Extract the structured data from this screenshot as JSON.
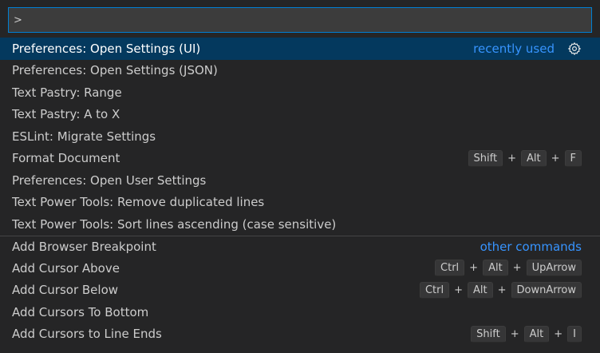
{
  "input": {
    "value": ">",
    "placeholder": ""
  },
  "items": [
    {
      "label": "Preferences: Open Settings (UI)",
      "group": "recently used",
      "keys": [],
      "selected": true,
      "separator": false,
      "gear": true
    },
    {
      "label": "Preferences: Open Settings (JSON)",
      "group": "",
      "keys": [],
      "selected": false,
      "separator": false,
      "gear": false
    },
    {
      "label": "Text Pastry: Range",
      "group": "",
      "keys": [],
      "selected": false,
      "separator": false,
      "gear": false
    },
    {
      "label": "Text Pastry: A to X",
      "group": "",
      "keys": [],
      "selected": false,
      "separator": false,
      "gear": false
    },
    {
      "label": "ESLint: Migrate Settings",
      "group": "",
      "keys": [],
      "selected": false,
      "separator": false,
      "gear": false
    },
    {
      "label": "Format Document",
      "group": "",
      "keys": [
        "Shift",
        "Alt",
        "F"
      ],
      "selected": false,
      "separator": false,
      "gear": false
    },
    {
      "label": "Preferences: Open User Settings",
      "group": "",
      "keys": [],
      "selected": false,
      "separator": false,
      "gear": false
    },
    {
      "label": "Text Power Tools: Remove duplicated lines",
      "group": "",
      "keys": [],
      "selected": false,
      "separator": false,
      "gear": false
    },
    {
      "label": "Text Power Tools: Sort lines ascending (case sensitive)",
      "group": "",
      "keys": [],
      "selected": false,
      "separator": false,
      "gear": false
    },
    {
      "label": "Add Browser Breakpoint",
      "group": "other commands",
      "keys": [],
      "selected": false,
      "separator": true,
      "gear": false
    },
    {
      "label": "Add Cursor Above",
      "group": "",
      "keys": [
        "Ctrl",
        "Alt",
        "UpArrow"
      ],
      "selected": false,
      "separator": false,
      "gear": false
    },
    {
      "label": "Add Cursor Below",
      "group": "",
      "keys": [
        "Ctrl",
        "Alt",
        "DownArrow"
      ],
      "selected": false,
      "separator": false,
      "gear": false
    },
    {
      "label": "Add Cursors To Bottom",
      "group": "",
      "keys": [],
      "selected": false,
      "separator": false,
      "gear": false
    },
    {
      "label": "Add Cursors to Line Ends",
      "group": "",
      "keys": [
        "Shift",
        "Alt",
        "I"
      ],
      "selected": false,
      "separator": false,
      "gear": false
    }
  ],
  "plus_sign": "+",
  "colors": {
    "accent": "#3794ff",
    "selected_bg": "#04395e",
    "focus_border": "#007fd4",
    "background": "#252526"
  },
  "icons": {
    "gear": "gear-icon"
  }
}
